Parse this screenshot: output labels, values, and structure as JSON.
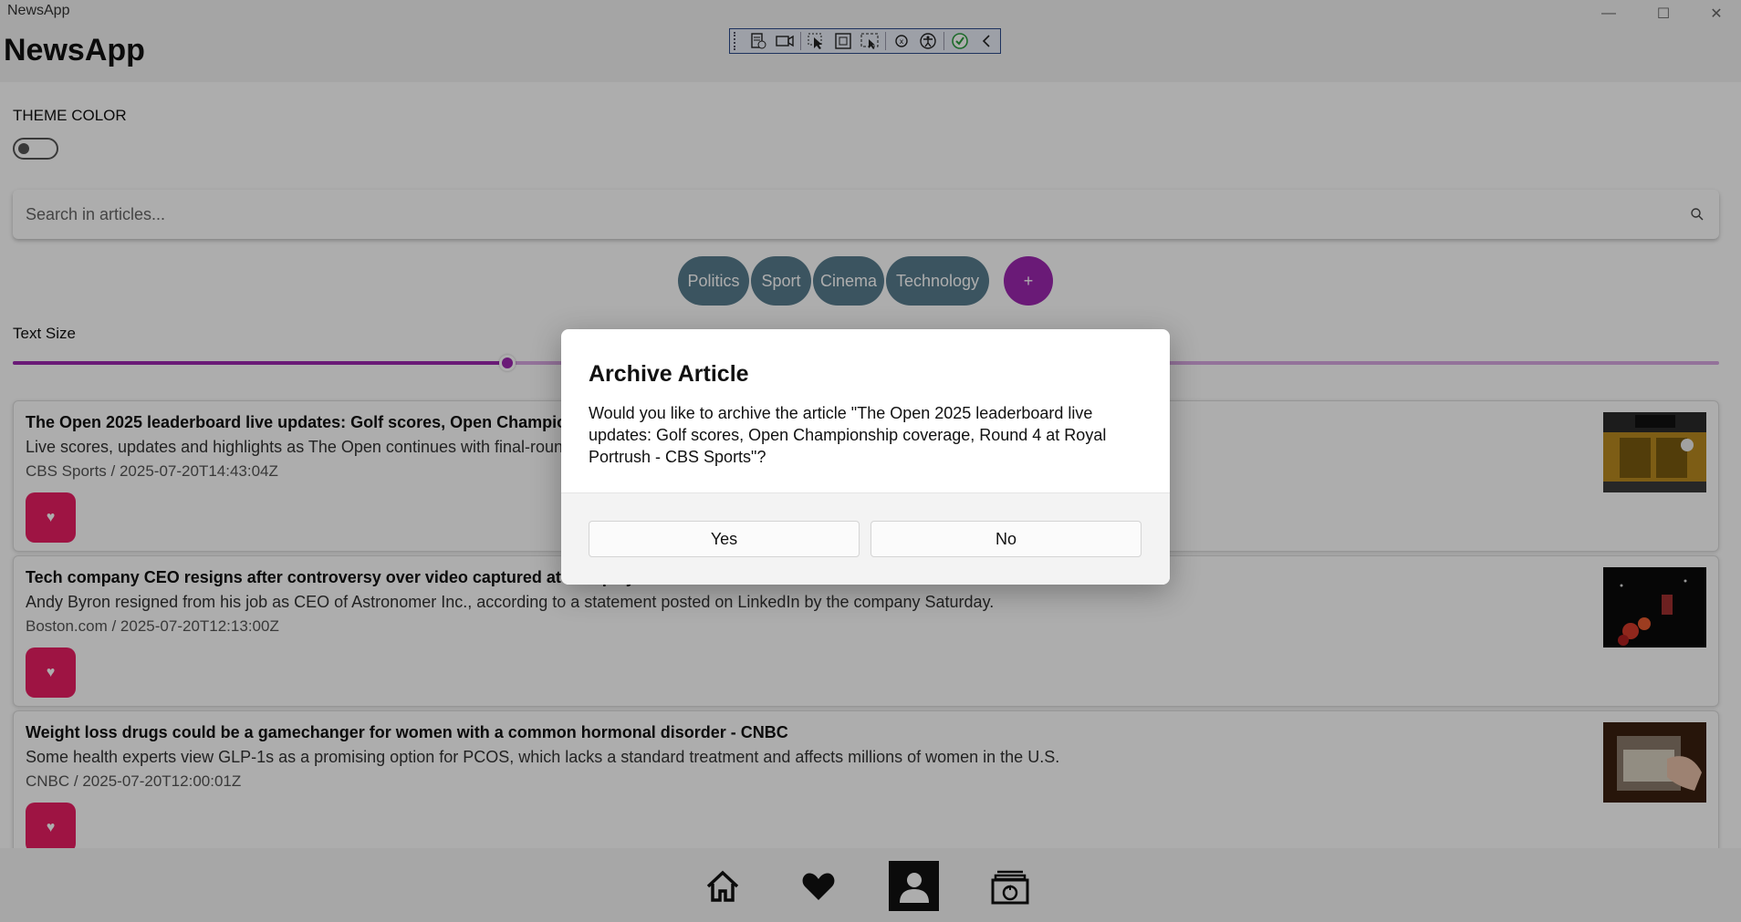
{
  "window": {
    "title": "NewsApp",
    "minimize_glyph": "—",
    "maximize_glyph": "☐",
    "close_glyph": "✕"
  },
  "header": {
    "app_name": "NewsApp"
  },
  "devtools_toolbar": {
    "icons": [
      "live-visual-tree-icon",
      "record-icon",
      "select-element-icon",
      "display-layout-adorners-icon",
      "track-focus-icon",
      "binding-failures-icon",
      "accessibility-icon",
      "hot-reload-ok-icon",
      "collapse-toolbar-icon"
    ]
  },
  "theme": {
    "label": "THEME COLOR",
    "toggle_on": false
  },
  "search": {
    "placeholder": "Search in articles..."
  },
  "categories": [
    {
      "label": "Politics"
    },
    {
      "label": "Sport"
    },
    {
      "label": "Cinema"
    },
    {
      "label": "Technology"
    }
  ],
  "add_category": {
    "label": "+"
  },
  "text_size": {
    "label": "Text Size",
    "value_fraction": 0.29
  },
  "articles": [
    {
      "title": "The Open 2025 leaderboard live updates: Golf scores, Open Championship coverage, Round 4 at Royal Portrush - CBS Sports",
      "description": "Live scores, updates and highlights as The Open continues with final-round action at Royal Portrush.",
      "meta": "CBS Sports / 2025-07-20T14:43:04Z",
      "favorite_glyph": "♥"
    },
    {
      "title": "Tech company CEO resigns after controversy over video captured at Coldplay concert - Boston.com",
      "description": "Andy Byron resigned from his job as CEO of Astronomer Inc., according to a statement posted on LinkedIn by the company Saturday.",
      "meta": "Boston.com / 2025-07-20T12:13:00Z",
      "favorite_glyph": "♥"
    },
    {
      "title": "Weight loss drugs could be a gamechanger for women with a common hormonal disorder - CNBC",
      "description": "Some health experts view GLP-1s as a promising option for PCOS, which lacks a standard treatment and affects millions of women in the U.S.",
      "meta": "CNBC / 2025-07-20T12:00:01Z",
      "favorite_glyph": "♥"
    }
  ],
  "bottom_nav": {
    "items": [
      {
        "icon": "home-icon",
        "selected": false
      },
      {
        "icon": "heart-icon",
        "selected": false
      },
      {
        "icon": "profile-icon",
        "selected": true
      },
      {
        "icon": "archive-icon",
        "selected": false
      }
    ]
  },
  "dialog": {
    "title": "Archive Article",
    "message": "Would you like to archive the article \"The Open 2025 leaderboard live updates: Golf scores, Open Championship coverage, Round 4 at Royal Portrush - CBS Sports\"?",
    "yes_label": "Yes",
    "no_label": "No"
  },
  "colors": {
    "accent": "#9c27b0",
    "chip": "#587c8e",
    "favorite": "#e91e63"
  }
}
